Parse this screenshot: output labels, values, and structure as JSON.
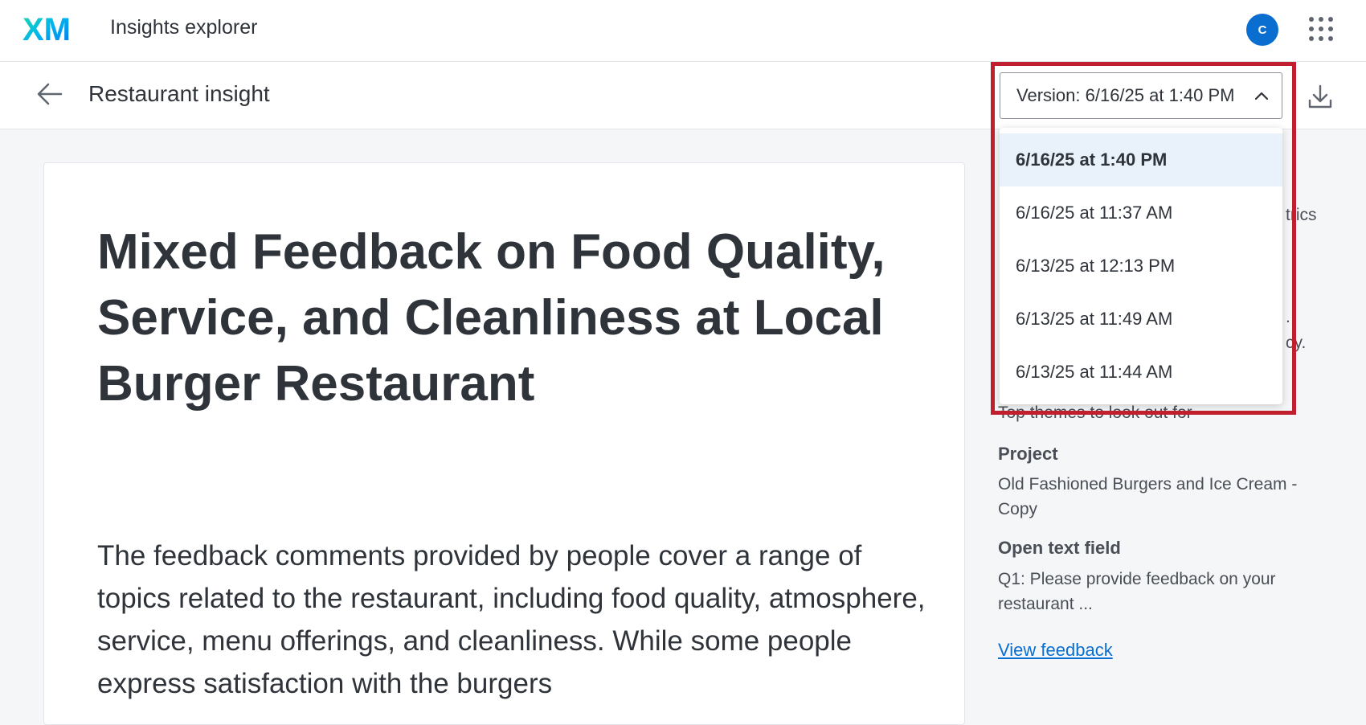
{
  "app": {
    "logo_text": "XM",
    "title": "Insights explorer",
    "avatar_initial": "C"
  },
  "header": {
    "page_title": "Restaurant insight",
    "version_label": "Version: 6/16/25 at 1:40 PM"
  },
  "version_dropdown": {
    "options": [
      "6/16/25 at 1:40 PM",
      "6/16/25 at 11:37 AM",
      "6/13/25 at 12:13 PM",
      "6/13/25 at 11:49 AM",
      "6/13/25 at 11:44 AM"
    ],
    "selected_index": 0
  },
  "insight": {
    "headline": "Mixed Feedback on Food Quality, Service, and Cleanliness at Local Burger Restaurant",
    "body": "The feedback comments provided by people cover a range of topics related to the restaurant, including food quality, atmosphere, service, menu offerings, and cleanliness. While some people express satisfaction with the burgers"
  },
  "side_panel": {
    "partial_text_1": "trics",
    "partial_text_2": ".",
    "partial_text_3": "cy.",
    "top_themes_label": "Top themes to look out for",
    "project_label": "Project",
    "project_value": "Old Fashioned Burgers and Ice Cream - Copy",
    "open_text_label": "Open text field",
    "open_text_value": "Q1: Please provide feedback on your restaurant ...",
    "view_feedback": "View feedback"
  },
  "colors": {
    "accent": "#0a6ed1",
    "highlight": "#c0202e",
    "selected_bg": "#e9f2fa"
  },
  "icons": {
    "back": "arrow-left-icon",
    "chevron": "chevron-up-icon",
    "download": "download-icon",
    "apps": "apps-grid-icon"
  }
}
